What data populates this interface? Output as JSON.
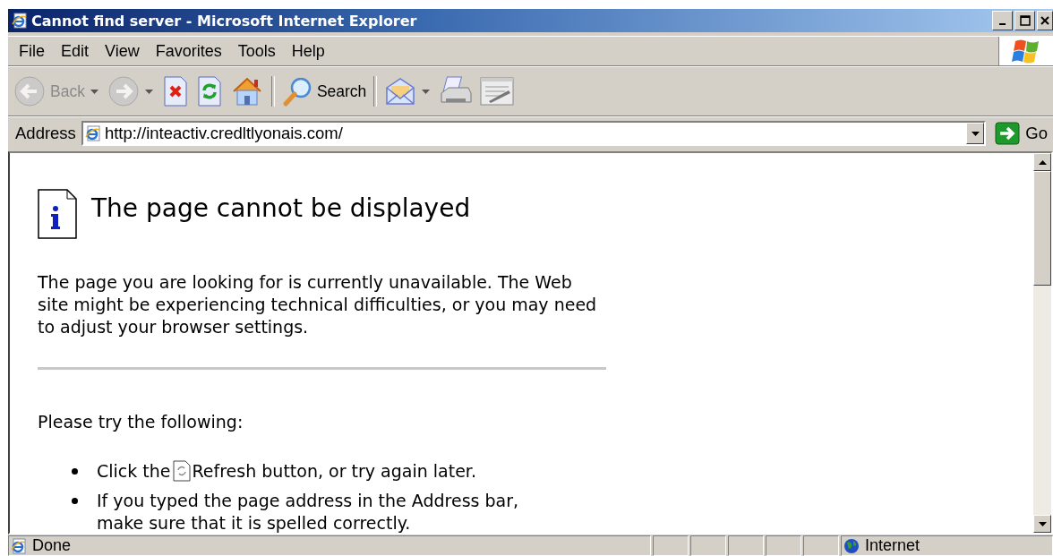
{
  "window": {
    "title": "Cannot find server - Microsoft Internet Explorer"
  },
  "menu": [
    {
      "label": "File"
    },
    {
      "label": "Edit"
    },
    {
      "label": "View"
    },
    {
      "label": "Favorites"
    },
    {
      "label": "Tools"
    },
    {
      "label": "Help"
    }
  ],
  "toolbar": [
    {
      "kind": "back",
      "label": "Back",
      "disabled": true,
      "dropdown": true
    },
    {
      "kind": "forward",
      "disabled": true,
      "dropdown": true
    },
    {
      "kind": "stop",
      "disabled": false
    },
    {
      "kind": "refresh",
      "disabled": false
    },
    {
      "kind": "home",
      "disabled": false
    },
    {
      "kind": "separator"
    },
    {
      "kind": "search",
      "label": "Search",
      "disabled": false
    },
    {
      "kind": "separator"
    },
    {
      "kind": "mail",
      "disabled": false,
      "dropdown": true
    },
    {
      "kind": "print",
      "disabled": false
    },
    {
      "kind": "edit",
      "disabled": false
    }
  ],
  "address_bar": {
    "label": "Address",
    "value": "http://inteactiv.credltlyonais.com/",
    "go_label": "Go"
  },
  "page": {
    "heading": "The page cannot be displayed",
    "intro": "The page you are looking for is currently unavailable. The Web site might be experiencing technical difficulties, or you may need to adjust your browser settings.",
    "try_heading": "Please try the following:",
    "suggestions": [
      {
        "kind": "refresh",
        "text_before": "Click the",
        "text_after": "Refresh button, or try again later."
      },
      {
        "kind": "text",
        "text": "If you typed the page address in the Address bar, make sure that it is spelled correctly."
      }
    ]
  },
  "status_bar": {
    "text": "Done",
    "zone": "Internet"
  }
}
